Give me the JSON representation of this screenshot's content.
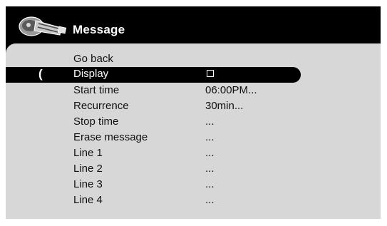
{
  "menu": {
    "title": "Message",
    "logo_icon": "remote-control-icon",
    "cursor_glyph": "(",
    "items": [
      {
        "label": "Go back",
        "value": ""
      },
      {
        "label": "Display",
        "value": "",
        "checkbox_checked": false,
        "selected": true
      },
      {
        "label": "Start time",
        "value": "06:00PM..."
      },
      {
        "label": "Recurrence",
        "value": "30min..."
      },
      {
        "label": "Stop time",
        "value": "..."
      },
      {
        "label": "Erase message",
        "value": "..."
      },
      {
        "label": "Line 1",
        "value": "..."
      },
      {
        "label": "Line 2",
        "value": "..."
      },
      {
        "label": "Line 3",
        "value": "..."
      },
      {
        "label": "Line 4",
        "value": "..."
      }
    ]
  },
  "colors": {
    "panel_background": "#000000",
    "body_background": "#d7d7d7",
    "highlight": "#000000",
    "text": "#111111",
    "highlight_text": "#ffffff"
  }
}
